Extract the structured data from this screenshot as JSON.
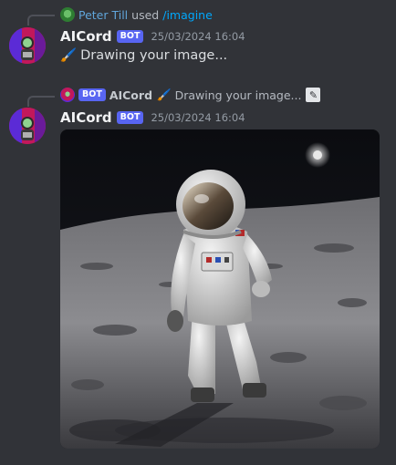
{
  "message1": {
    "reply": {
      "user_name": "Peter Till",
      "used_text": "used",
      "command": "/imagine"
    },
    "author": "AICord",
    "bot_tag": "BOT",
    "timestamp": "25/03/2024 16:04",
    "brush_emoji": "🖌️",
    "content": "Drawing your image..."
  },
  "message2": {
    "reply": {
      "bot_tag": "BOT",
      "author": "AICord",
      "brush_emoji": "🖌️",
      "snippet": "Drawing your image...",
      "edit_icon": "pencil-edit-icon"
    },
    "author": "AICord",
    "bot_tag": "BOT",
    "timestamp": "25/03/2024 16:04",
    "image_subject": "astronaut-on-moon-image"
  },
  "colors": {
    "background": "#313338",
    "username": "#f2f3f5",
    "bot_tag": "#5865f2",
    "timestamp": "#949ba4",
    "reply_name": "#60a5da",
    "command": "#00a8fc"
  }
}
